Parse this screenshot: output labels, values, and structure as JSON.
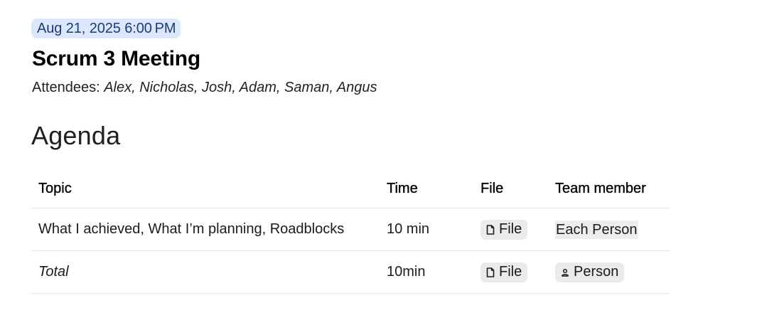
{
  "meeting": {
    "date": "Aug 21, 2025 6:00 PM",
    "title": "Scrum 3 Meeting",
    "attendees_label": "Attendees: ",
    "attendees_names": "Alex, Nicholas, Josh, Adam, Saman, Angus"
  },
  "agenda": {
    "heading": "Agenda",
    "columns": [
      "Topic",
      "Time",
      "File",
      "Team member"
    ],
    "rows": [
      {
        "topic": "What I achieved, What I’m planning, Roadblocks",
        "time": "10 min",
        "file": "File",
        "member": "Each Person"
      },
      {
        "topic": "Total",
        "time": "10min",
        "file": "File",
        "member": "Person"
      }
    ]
  },
  "icons": {
    "file_chip_icon": "document-icon",
    "person_chip_icon": "person-icon"
  },
  "colors": {
    "date_chip_bg": "#dbe8fb",
    "date_chip_text": "#1a3d7a",
    "chip_bg": "#ebebeb",
    "divider": "#e4e4e4"
  }
}
